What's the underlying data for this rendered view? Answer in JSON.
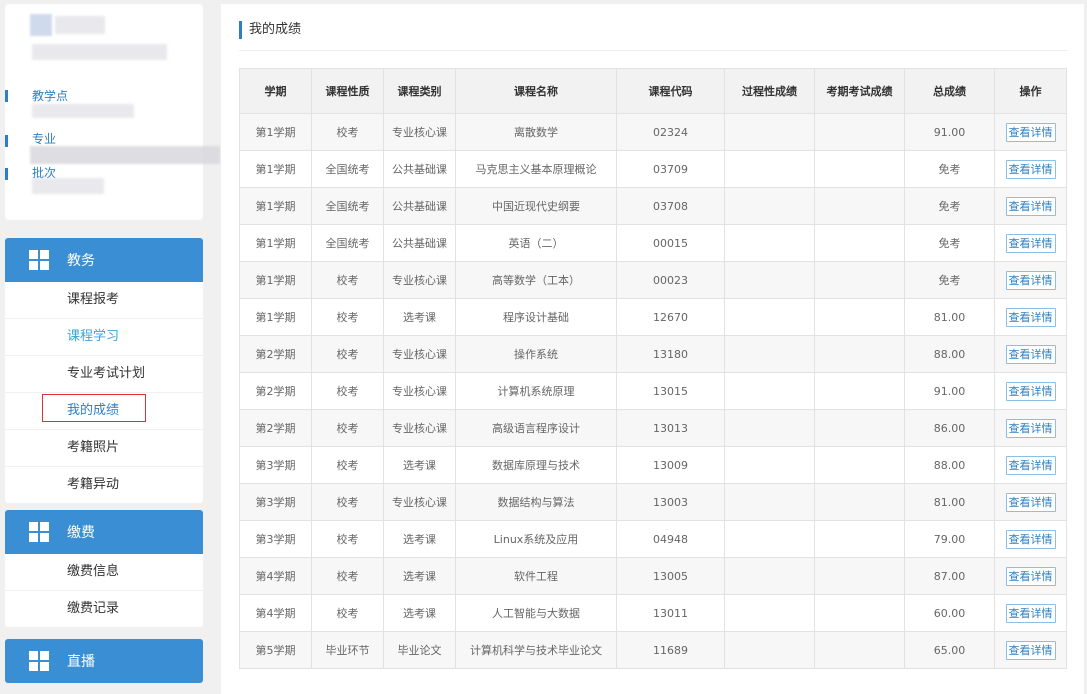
{
  "sidebar": {
    "profile": {
      "labels": [
        "教学点",
        "专业",
        "批次"
      ]
    },
    "groups": [
      {
        "title": "教务",
        "icon": "grid-icon",
        "items": [
          {
            "label": "课程报考"
          },
          {
            "label": "课程学习"
          },
          {
            "label": "专业考试计划"
          },
          {
            "label": "我的成绩"
          },
          {
            "label": "考籍照片"
          },
          {
            "label": "考籍异动"
          }
        ]
      },
      {
        "title": "缴费",
        "icon": "grid-icon",
        "items": [
          {
            "label": "缴费信息"
          },
          {
            "label": "缴费记录"
          }
        ]
      },
      {
        "title": "直播",
        "icon": "grid-icon",
        "items": []
      }
    ]
  },
  "main": {
    "title": "我的成绩",
    "columns": [
      "学期",
      "课程性质",
      "课程类别",
      "课程名称",
      "课程代码",
      "过程性成绩",
      "考期考试成绩",
      "总成绩",
      "操作"
    ],
    "action_label": "查看详情",
    "rows": [
      [
        "第1学期",
        "校考",
        "专业核心课",
        "离散数学",
        "02324",
        "",
        "",
        "91.00"
      ],
      [
        "第1学期",
        "全国统考",
        "公共基础课",
        "马克思主义基本原理概论",
        "03709",
        "",
        "",
        "免考"
      ],
      [
        "第1学期",
        "全国统考",
        "公共基础课",
        "中国近现代史纲要",
        "03708",
        "",
        "",
        "免考"
      ],
      [
        "第1学期",
        "全国统考",
        "公共基础课",
        "英语（二）",
        "00015",
        "",
        "",
        "免考"
      ],
      [
        "第1学期",
        "校考",
        "专业核心课",
        "高等数学（工本）",
        "00023",
        "",
        "",
        "免考"
      ],
      [
        "第1学期",
        "校考",
        "选考课",
        "程序设计基础",
        "12670",
        "",
        "",
        "81.00"
      ],
      [
        "第2学期",
        "校考",
        "专业核心课",
        "操作系统",
        "13180",
        "",
        "",
        "88.00"
      ],
      [
        "第2学期",
        "校考",
        "专业核心课",
        "计算机系统原理",
        "13015",
        "",
        "",
        "91.00"
      ],
      [
        "第2学期",
        "校考",
        "专业核心课",
        "高级语言程序设计",
        "13013",
        "",
        "",
        "86.00"
      ],
      [
        "第3学期",
        "校考",
        "选考课",
        "数据库原理与技术",
        "13009",
        "",
        "",
        "88.00"
      ],
      [
        "第3学期",
        "校考",
        "专业核心课",
        "数据结构与算法",
        "13003",
        "",
        "",
        "81.00"
      ],
      [
        "第3学期",
        "校考",
        "选考课",
        "Linux系统及应用",
        "04948",
        "",
        "",
        "79.00"
      ],
      [
        "第4学期",
        "校考",
        "选考课",
        "软件工程",
        "13005",
        "",
        "",
        "87.00"
      ],
      [
        "第4学期",
        "校考",
        "选考课",
        "人工智能与大数据",
        "13011",
        "",
        "",
        "60.00"
      ],
      [
        "第5学期",
        "毕业环节",
        "毕业论文",
        "计算机科学与技术毕业论文",
        "11689",
        "",
        "",
        "65.00"
      ]
    ]
  },
  "colors": {
    "accent": "#3a8ed3",
    "link": "#2d7fc3",
    "highlight_box": "#e0313a"
  }
}
